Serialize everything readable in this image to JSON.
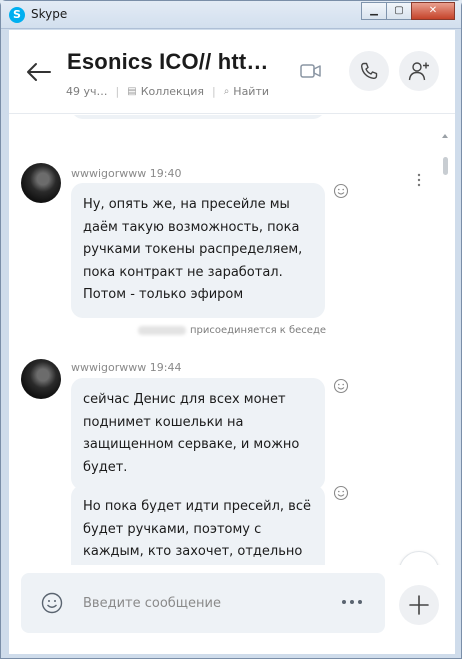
{
  "window": {
    "app_title": "Skype"
  },
  "header": {
    "title": "Esonics ICO// htt…",
    "participants": "49 уч…",
    "gallery_label": "Коллекция",
    "find_label": "Найти"
  },
  "messages": [
    {
      "sender_time": "wwwigorwww 19:40",
      "bubbles": [
        {
          "text": "Ну, опять же, на пресейле мы даём такую возможность, пока ручками токены распределяем, пока контракт не заработал. Потом - только эфиром"
        }
      ]
    },
    {
      "system": "присоединяется к беседе"
    },
    {
      "sender_time": "wwwigorwww 19:44",
      "bubbles": [
        {
          "text": "сейчас Денис для всех монет поднимет кошельки на защищенном серваке, и можно будет."
        },
        {
          "text": "Но пока будет идти пресейл, всё будет ручками, поэтому с каждым, кто захочет, отдельно будем решать"
        }
      ]
    }
  ],
  "composer": {
    "placeholder": "Введите сообщение"
  },
  "colors": {
    "accent": "#00aff0",
    "bubble": "#eef2f6",
    "icon": "#5a6470"
  }
}
